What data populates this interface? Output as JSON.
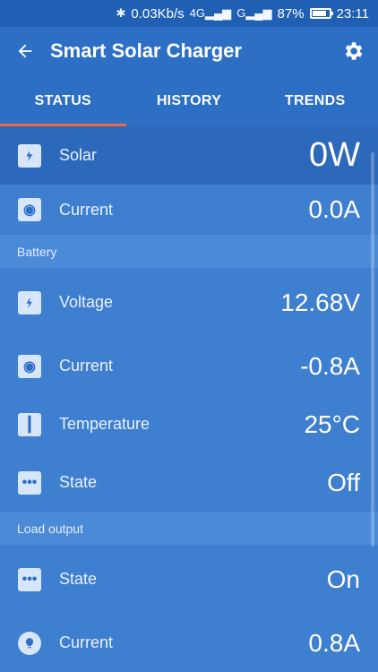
{
  "status_bar": {
    "speed": "0.03Kb/s",
    "network_1": "4G",
    "network_2": "G",
    "battery_percent": "87%",
    "battery_level": 0.87,
    "time": "23:11"
  },
  "app": {
    "title": "Smart Solar Charger"
  },
  "tabs": [
    {
      "label": "STATUS",
      "active": true
    },
    {
      "label": "HISTORY",
      "active": false
    },
    {
      "label": "TRENDS",
      "active": false
    }
  ],
  "solar": {
    "rows": [
      {
        "label": "Solar",
        "value": "0W",
        "icon": "solar-panel-icon"
      },
      {
        "label": "Current",
        "value": "0.0A",
        "icon": "current-icon"
      }
    ]
  },
  "battery": {
    "section_label": "Battery",
    "rows": [
      {
        "label": "Voltage",
        "value": "12.68V",
        "icon": "battery-voltage-icon"
      },
      {
        "label": "Current",
        "value": "-0.8A",
        "icon": "current-icon"
      },
      {
        "label": "Temperature",
        "value": "25°C",
        "icon": "thermometer-icon"
      },
      {
        "label": "State",
        "value": "Off",
        "icon": "dots-icon"
      }
    ]
  },
  "load": {
    "section_label": "Load output",
    "rows": [
      {
        "label": "State",
        "value": "On",
        "icon": "dots-icon"
      },
      {
        "label": "Current",
        "value": "0.8A",
        "icon": "bulb-icon"
      }
    ]
  }
}
